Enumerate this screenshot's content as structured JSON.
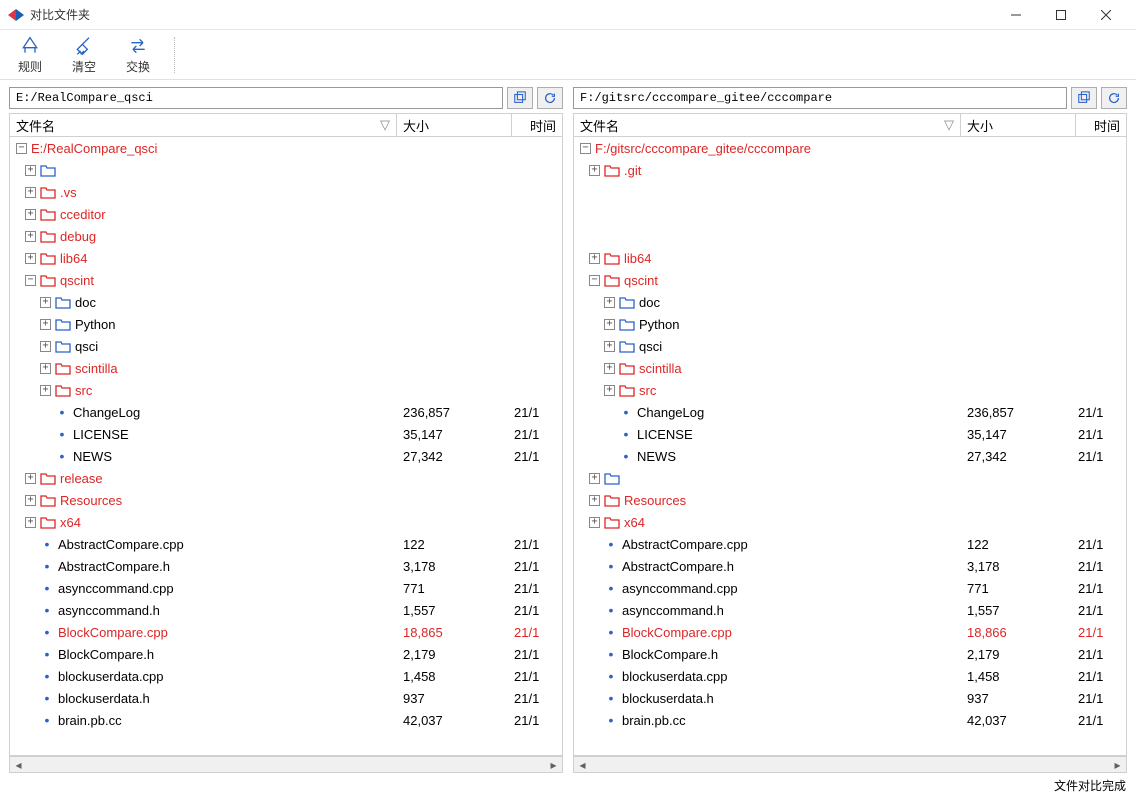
{
  "window": {
    "title": "对比文件夹"
  },
  "toolbar": {
    "rules": "规则",
    "clear": "清空",
    "swap": "交换"
  },
  "headers": {
    "name": "文件名",
    "size": "大小",
    "time": "时间"
  },
  "status": "文件对比完成",
  "left": {
    "path": "E:/RealCompare_qsci",
    "root": "E:/RealCompare_qsci",
    "rows": [
      {
        "indent": 1,
        "type": "folder",
        "exp": "plus",
        "name": "",
        "diff": false,
        "size": "",
        "time": ""
      },
      {
        "indent": 1,
        "type": "folder",
        "exp": "plus",
        "name": ".vs",
        "diff": true,
        "size": "",
        "time": ""
      },
      {
        "indent": 1,
        "type": "folder",
        "exp": "plus",
        "name": "cceditor",
        "diff": true,
        "size": "",
        "time": ""
      },
      {
        "indent": 1,
        "type": "folder",
        "exp": "plus",
        "name": "debug",
        "diff": true,
        "size": "",
        "time": ""
      },
      {
        "indent": 1,
        "type": "folder",
        "exp": "plus",
        "name": "lib64",
        "diff": true,
        "size": "",
        "time": ""
      },
      {
        "indent": 1,
        "type": "folder",
        "exp": "minus",
        "name": "qscint",
        "diff": true,
        "size": "",
        "time": ""
      },
      {
        "indent": 2,
        "type": "folder",
        "exp": "plus",
        "name": "doc",
        "diff": false,
        "size": "",
        "time": ""
      },
      {
        "indent": 2,
        "type": "folder",
        "exp": "plus",
        "name": "Python",
        "diff": false,
        "size": "",
        "time": ""
      },
      {
        "indent": 2,
        "type": "folder",
        "exp": "plus",
        "name": "qsci",
        "diff": false,
        "size": "",
        "time": ""
      },
      {
        "indent": 2,
        "type": "folder",
        "exp": "plus",
        "name": "scintilla",
        "diff": true,
        "size": "",
        "time": ""
      },
      {
        "indent": 2,
        "type": "folder",
        "exp": "plus",
        "name": "src",
        "diff": true,
        "size": "",
        "time": ""
      },
      {
        "indent": 2,
        "type": "file",
        "name": "ChangeLog",
        "diff": false,
        "size": "236,857",
        "time": "21/1"
      },
      {
        "indent": 2,
        "type": "file",
        "name": "LICENSE",
        "diff": false,
        "size": "35,147",
        "time": "21/1"
      },
      {
        "indent": 2,
        "type": "file",
        "name": "NEWS",
        "diff": false,
        "size": "27,342",
        "time": "21/1"
      },
      {
        "indent": 1,
        "type": "folder",
        "exp": "plus",
        "name": "release",
        "diff": true,
        "size": "",
        "time": ""
      },
      {
        "indent": 1,
        "type": "folder",
        "exp": "plus",
        "name": "Resources",
        "diff": true,
        "size": "",
        "time": ""
      },
      {
        "indent": 1,
        "type": "folder",
        "exp": "plus",
        "name": "x64",
        "diff": true,
        "size": "",
        "time": ""
      },
      {
        "indent": 1,
        "type": "file",
        "name": "AbstractCompare.cpp",
        "diff": false,
        "size": "122",
        "time": "21/1"
      },
      {
        "indent": 1,
        "type": "file",
        "name": "AbstractCompare.h",
        "diff": false,
        "size": "3,178",
        "time": "21/1"
      },
      {
        "indent": 1,
        "type": "file",
        "name": "asynccommand.cpp",
        "diff": false,
        "size": "771",
        "time": "21/1"
      },
      {
        "indent": 1,
        "type": "file",
        "name": "asynccommand.h",
        "diff": false,
        "size": "1,557",
        "time": "21/1"
      },
      {
        "indent": 1,
        "type": "file",
        "name": "BlockCompare.cpp",
        "diff": true,
        "size": "18,865",
        "time": "21/1"
      },
      {
        "indent": 1,
        "type": "file",
        "name": "BlockCompare.h",
        "diff": false,
        "size": "2,179",
        "time": "21/1"
      },
      {
        "indent": 1,
        "type": "file",
        "name": "blockuserdata.cpp",
        "diff": false,
        "size": "1,458",
        "time": "21/1"
      },
      {
        "indent": 1,
        "type": "file",
        "name": "blockuserdata.h",
        "diff": false,
        "size": "937",
        "time": "21/1"
      },
      {
        "indent": 1,
        "type": "file",
        "name": "brain.pb.cc",
        "diff": false,
        "size": "42,037",
        "time": "21/1"
      }
    ]
  },
  "right": {
    "path": "F:/gitsrc/cccompare_gitee/cccompare",
    "root": "F:/gitsrc/cccompare_gitee/cccompare",
    "rows": [
      {
        "indent": 1,
        "type": "folder",
        "exp": "plus",
        "name": ".git",
        "diff": true,
        "size": "",
        "time": ""
      },
      {
        "indent": 1,
        "type": "blank"
      },
      {
        "indent": 1,
        "type": "blank"
      },
      {
        "indent": 1,
        "type": "blank"
      },
      {
        "indent": 1,
        "type": "folder",
        "exp": "plus",
        "name": "lib64",
        "diff": true,
        "size": "",
        "time": ""
      },
      {
        "indent": 1,
        "type": "folder",
        "exp": "minus",
        "name": "qscint",
        "diff": true,
        "size": "",
        "time": ""
      },
      {
        "indent": 2,
        "type": "folder",
        "exp": "plus",
        "name": "doc",
        "diff": false,
        "size": "",
        "time": ""
      },
      {
        "indent": 2,
        "type": "folder",
        "exp": "plus",
        "name": "Python",
        "diff": false,
        "size": "",
        "time": ""
      },
      {
        "indent": 2,
        "type": "folder",
        "exp": "plus",
        "name": "qsci",
        "diff": false,
        "size": "",
        "time": ""
      },
      {
        "indent": 2,
        "type": "folder",
        "exp": "plus",
        "name": "scintilla",
        "diff": true,
        "size": "",
        "time": ""
      },
      {
        "indent": 2,
        "type": "folder",
        "exp": "plus",
        "name": "src",
        "diff": true,
        "size": "",
        "time": ""
      },
      {
        "indent": 2,
        "type": "file",
        "name": "ChangeLog",
        "diff": false,
        "size": "236,857",
        "time": "21/1"
      },
      {
        "indent": 2,
        "type": "file",
        "name": "LICENSE",
        "diff": false,
        "size": "35,147",
        "time": "21/1"
      },
      {
        "indent": 2,
        "type": "file",
        "name": "NEWS",
        "diff": false,
        "size": "27,342",
        "time": "21/1"
      },
      {
        "indent": 1,
        "type": "folder",
        "exp": "plus",
        "name": "",
        "diff": false,
        "size": "",
        "time": ""
      },
      {
        "indent": 1,
        "type": "folder",
        "exp": "plus",
        "name": "Resources",
        "diff": true,
        "size": "",
        "time": ""
      },
      {
        "indent": 1,
        "type": "folder",
        "exp": "plus",
        "name": "x64",
        "diff": true,
        "size": "",
        "time": ""
      },
      {
        "indent": 1,
        "type": "file",
        "name": "AbstractCompare.cpp",
        "diff": false,
        "size": "122",
        "time": "21/1"
      },
      {
        "indent": 1,
        "type": "file",
        "name": "AbstractCompare.h",
        "diff": false,
        "size": "3,178",
        "time": "21/1"
      },
      {
        "indent": 1,
        "type": "file",
        "name": "asynccommand.cpp",
        "diff": false,
        "size": "771",
        "time": "21/1"
      },
      {
        "indent": 1,
        "type": "file",
        "name": "asynccommand.h",
        "diff": false,
        "size": "1,557",
        "time": "21/1"
      },
      {
        "indent": 1,
        "type": "file",
        "name": "BlockCompare.cpp",
        "diff": true,
        "size": "18,866",
        "time": "21/1"
      },
      {
        "indent": 1,
        "type": "file",
        "name": "BlockCompare.h",
        "diff": false,
        "size": "2,179",
        "time": "21/1"
      },
      {
        "indent": 1,
        "type": "file",
        "name": "blockuserdata.cpp",
        "diff": false,
        "size": "1,458",
        "time": "21/1"
      },
      {
        "indent": 1,
        "type": "file",
        "name": "blockuserdata.h",
        "diff": false,
        "size": "937",
        "time": "21/1"
      },
      {
        "indent": 1,
        "type": "file",
        "name": "brain.pb.cc",
        "diff": false,
        "size": "42,037",
        "time": "21/1"
      }
    ]
  }
}
